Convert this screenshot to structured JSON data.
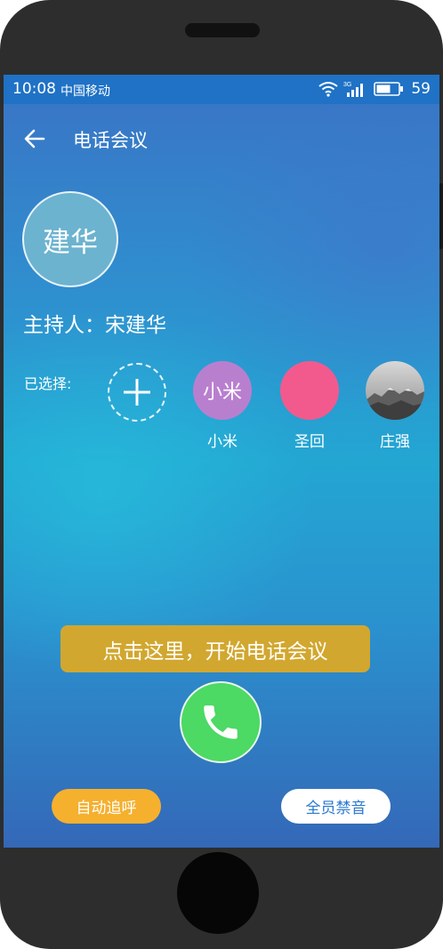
{
  "status_bar": {
    "time": "10:08",
    "carrier": "中国移动",
    "network_label": "3G",
    "battery": "59"
  },
  "header": {
    "title": "电话会议",
    "back_icon": "arrow-left-icon"
  },
  "host": {
    "avatar_text": "建华",
    "label": "主持人：宋建华"
  },
  "participants": {
    "label": "已选择:",
    "add_icon": "plus-icon",
    "members": [
      {
        "avatar_text": "小米",
        "name": "小米",
        "color": "#b97fcf"
      },
      {
        "avatar_text": "",
        "name": "圣回",
        "color": "#f25a8e"
      },
      {
        "avatar_text": "",
        "name": "庄强",
        "color": "#9a9a9a"
      }
    ]
  },
  "call": {
    "prompt": "点击这里，开始电话会议",
    "icon": "phone-icon"
  },
  "actions": {
    "auto_redial": "自动追呼",
    "mute_all": "全员禁音"
  },
  "colors": {
    "status_bar": "#1f72c6",
    "cta_banner": "#d2a72f",
    "call_button": "#4cd964",
    "auto_button": "#f5b02e",
    "mute_text": "#2b7ad0"
  }
}
